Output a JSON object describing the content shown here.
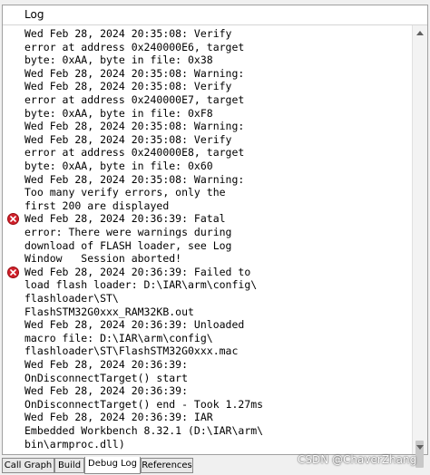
{
  "header": {
    "title": "Log"
  },
  "log_lines": [
    "Wed Feb 28, 2024 20:35:08: Verify",
    "error at address 0x240000E6, target",
    "byte: 0xAA, byte in file: 0x38",
    "Wed Feb 28, 2024 20:35:08: Warning:",
    "Wed Feb 28, 2024 20:35:08: Verify",
    "error at address 0x240000E7, target",
    "byte: 0xAA, byte in file: 0xF8",
    "Wed Feb 28, 2024 20:35:08: Warning:",
    "Wed Feb 28, 2024 20:35:08: Verify",
    "error at address 0x240000E8, target",
    "byte: 0xAA, byte in file: 0x60",
    "Wed Feb 28, 2024 20:35:08: Warning:",
    "Too many verify errors, only the",
    "first 200 are displayed",
    "Wed Feb 28, 2024 20:36:39: Fatal",
    "error: There were warnings during",
    "download of FLASH loader, see Log",
    "Window   Session aborted!",
    "Wed Feb 28, 2024 20:36:39: Failed to",
    "load flash loader: D:\\IAR\\arm\\config\\",
    "flashloader\\ST\\",
    "FlashSTM32G0xxx_RAM32KB.out",
    "Wed Feb 28, 2024 20:36:39: Unloaded",
    "macro file: D:\\IAR\\arm\\config\\",
    "flashloader\\ST\\FlashSTM32G0xxx.mac",
    "Wed Feb 28, 2024 20:36:39:",
    "OnDisconnectTarget() start",
    "Wed Feb 28, 2024 20:36:39:",
    "OnDisconnectTarget() end - Took 1.27ms",
    "Wed Feb 28, 2024 20:36:39: IAR",
    "Embedded Workbench 8.32.1 (D:\\IAR\\arm\\",
    "bin\\armproc.dll)"
  ],
  "error_line_indices": [
    14,
    18
  ],
  "tabs": [
    {
      "label": "Call Graph",
      "active": false
    },
    {
      "label": "Build",
      "active": false
    },
    {
      "label": "Debug Log",
      "active": true
    },
    {
      "label": "References",
      "active": false
    }
  ],
  "watermark": "CSDN @ChaverZhang",
  "icons": {
    "error": "error-icon",
    "scroll_up": "scroll-up-arrow-icon",
    "scroll_down": "scroll-down-arrow-icon"
  },
  "colors": {
    "error": "#d0202a",
    "border": "#a0a0a0",
    "background": "#ffffff"
  }
}
